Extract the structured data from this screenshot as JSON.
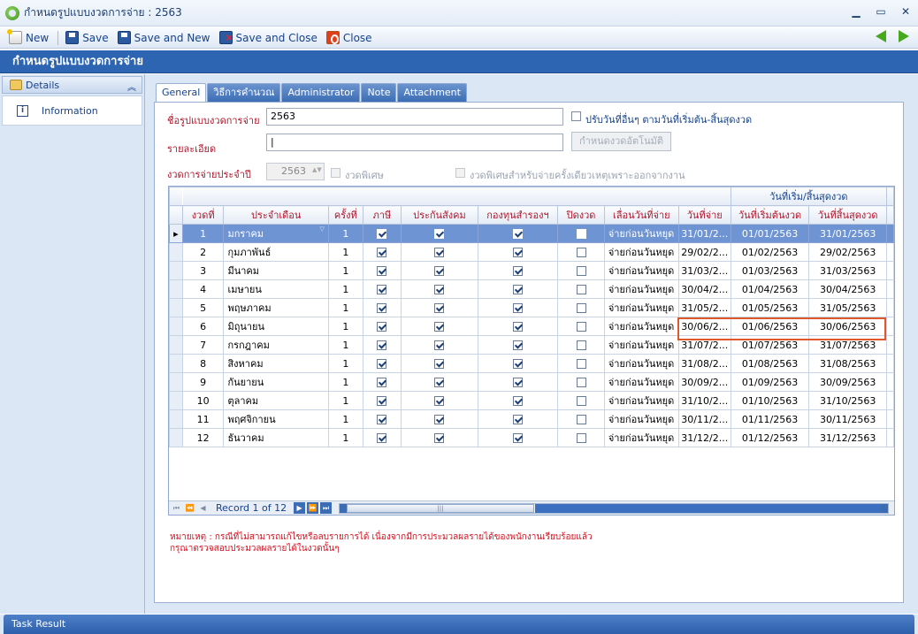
{
  "window": {
    "title": "กำหนดรูปแบบงวดการจ่าย : 2563",
    "min": "▁",
    "max": "▭",
    "close": "✕"
  },
  "toolbar": {
    "new_label": "New",
    "save_label": "Save",
    "save_new_label": "Save and New",
    "save_close_label": "Save and Close",
    "close_label": "Close"
  },
  "banner": {
    "title": "กำหนดรูปแบบงวดการจ่าย"
  },
  "left_nav": {
    "group_label": "Details",
    "items": [
      {
        "label": "Information"
      }
    ]
  },
  "tabs": [
    {
      "label": "General"
    },
    {
      "label": "วิธีการคำนวณ"
    },
    {
      "label": "Administrator"
    },
    {
      "label": "Note"
    },
    {
      "label": "Attachment"
    }
  ],
  "form": {
    "name_label": "ชื่อรูปแบบงวดการจ่าย",
    "name_value": "2563",
    "adjust_dates_label": "ปรับวันที่อื่นๆ ตามวันที่เริ่มต้น-สิ้นสุดงวด",
    "detail_label": "รายละเอียด",
    "detail_value": "|",
    "auto_button_label": "กำหนดงวดอัตโนมัติ",
    "year_label": "งวดการจ่ายประจำปี",
    "year_value": "2563",
    "special_label": "งวดพิเศษ",
    "special_once_label": "งวดพิเศษสำหรับจ่ายครั้งเดียวเหตุเพราะออกจากงาน"
  },
  "grid": {
    "group_header": "วันที่เริ่ม/สิ้นสุดงวด",
    "columns": [
      "งวดที่",
      "ประจำเดือน",
      "ครั้งที่",
      "ภาษี",
      "ประกันสังคม",
      "กองทุนสำรองฯ",
      "ปิดงวด",
      "เลื่อนวันที่จ่าย",
      "วันที่จ่าย",
      "วันที่เริ่มต้นงวด",
      "วันที่สิ้นสุดงวด"
    ],
    "rows": [
      {
        "no": "1",
        "month": "มกราคม",
        "times": "1",
        "pay_shift": "จ่ายก่อนวันหยุด",
        "pay_date": "31/01/2...",
        "start": "01/01/2563",
        "end": "31/01/2563"
      },
      {
        "no": "2",
        "month": "กุมภาพันธ์",
        "times": "1",
        "pay_shift": "จ่ายก่อนวันหยุด",
        "pay_date": "29/02/2...",
        "start": "01/02/2563",
        "end": "29/02/2563"
      },
      {
        "no": "3",
        "month": "มีนาคม",
        "times": "1",
        "pay_shift": "จ่ายก่อนวันหยุด",
        "pay_date": "31/03/2...",
        "start": "01/03/2563",
        "end": "31/03/2563"
      },
      {
        "no": "4",
        "month": "เมษายน",
        "times": "1",
        "pay_shift": "จ่ายก่อนวันหยุด",
        "pay_date": "30/04/2...",
        "start": "01/04/2563",
        "end": "30/04/2563"
      },
      {
        "no": "5",
        "month": "พฤษภาคม",
        "times": "1",
        "pay_shift": "จ่ายก่อนวันหยุด",
        "pay_date": "31/05/2...",
        "start": "01/05/2563",
        "end": "31/05/2563"
      },
      {
        "no": "6",
        "month": "มิถุนายน",
        "times": "1",
        "pay_shift": "จ่ายก่อนวันหยุด",
        "pay_date": "30/06/2...",
        "start": "01/06/2563",
        "end": "30/06/2563"
      },
      {
        "no": "7",
        "month": "กรกฎาคม",
        "times": "1",
        "pay_shift": "จ่ายก่อนวันหยุด",
        "pay_date": "31/07/2...",
        "start": "01/07/2563",
        "end": "31/07/2563"
      },
      {
        "no": "8",
        "month": "สิงหาคม",
        "times": "1",
        "pay_shift": "จ่ายก่อนวันหยุด",
        "pay_date": "31/08/2...",
        "start": "01/08/2563",
        "end": "31/08/2563"
      },
      {
        "no": "9",
        "month": "กันยายน",
        "times": "1",
        "pay_shift": "จ่ายก่อนวันหยุด",
        "pay_date": "30/09/2...",
        "start": "01/09/2563",
        "end": "30/09/2563"
      },
      {
        "no": "10",
        "month": "ตุลาคม",
        "times": "1",
        "pay_shift": "จ่ายก่อนวันหยุด",
        "pay_date": "31/10/2...",
        "start": "01/10/2563",
        "end": "31/10/2563"
      },
      {
        "no": "11",
        "month": "พฤศจิกายน",
        "times": "1",
        "pay_shift": "จ่ายก่อนวันหยุด",
        "pay_date": "30/11/2...",
        "start": "01/11/2563",
        "end": "30/11/2563"
      },
      {
        "no": "12",
        "month": "ธันวาคม",
        "times": "1",
        "pay_shift": "จ่ายก่อนวันหยุด",
        "pay_date": "31/12/2...",
        "start": "01/12/2563",
        "end": "31/12/2563"
      }
    ],
    "record_text": "Record 1 of 12",
    "scroll_grip": "|||"
  },
  "note": {
    "line1": "หมายเหตุ : กรณีที่ไม่สามารถแก้ไขหรือลบรายการได้ เนื่องจากมีการประมวลผลรายได้ของพนักงานเรียบร้อยแล้ว",
    "line2": "กรุณาตรวจสอบประมวลผลรายได้ในงวดนั้นๆ"
  },
  "taskbar": {
    "label": "Task Result"
  },
  "colors": {
    "accent": "#2d65b3",
    "label_red": "#b0162a",
    "highlight": "#e0582a",
    "selected_row": "#6f94d3"
  }
}
